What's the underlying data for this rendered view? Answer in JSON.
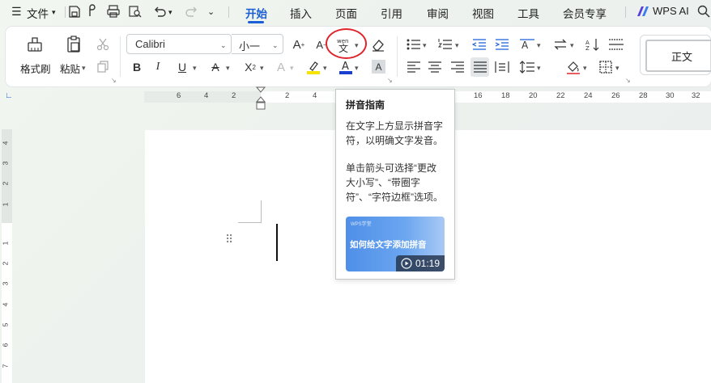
{
  "menubar": {
    "file_label": "文件",
    "tabs": [
      "开始",
      "插入",
      "页面",
      "引用",
      "审阅",
      "视图",
      "工具",
      "会员专享"
    ],
    "active_tab": "开始",
    "wps_ai_label": "WPS AI"
  },
  "ribbon": {
    "format_painter_label": "格式刷",
    "paste_label": "粘贴",
    "font_name": "Calibri",
    "font_size": "小一",
    "style_label": "正文"
  },
  "ruler": {
    "horizontal_numbers": [
      "6",
      "4",
      "2",
      "2",
      "4",
      "16",
      "18",
      "20",
      "22",
      "24",
      "26",
      "28",
      "30",
      "32"
    ],
    "vertical_numbers": [
      "4",
      "3",
      "2",
      "1",
      "1",
      "2",
      "3",
      "4",
      "5",
      "6",
      "7"
    ]
  },
  "tooltip": {
    "title": "拼音指南",
    "desc1": "在文字上方显示拼音字符，以明确文字发音。",
    "desc2": "单击箭头可选择“更改大小写”、“带圈字符”、“字符边框”选项。",
    "video_brand": "WPS学堂",
    "video_title": "如何给文字添加拼音",
    "video_duration": "01:19"
  },
  "colors": {
    "accent": "#1a5fd6",
    "highlight": "#f5e400",
    "font_color": "#1a3fd0",
    "annotation": "#e0242b"
  }
}
